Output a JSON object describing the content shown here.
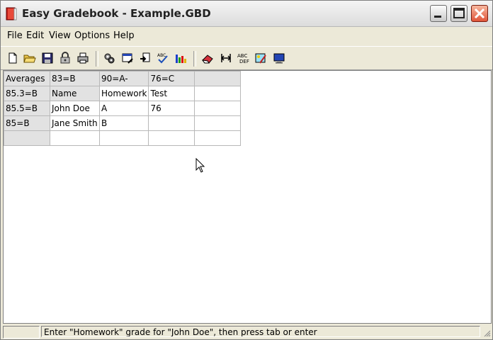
{
  "window": {
    "title": "Easy Gradebook - Example.GBD"
  },
  "menu": {
    "items": [
      "File",
      "Edit",
      "View",
      "Options",
      "Help"
    ]
  },
  "toolbar": {
    "icons": [
      "new-file-icon",
      "open-folder-icon",
      "save-disk-icon",
      "lock-icon",
      "print-icon",
      "settings-gears-icon",
      "window-edit-icon",
      "document-arrow-icon",
      "spell-check-icon",
      "bar-chart-icon",
      "eraser-icon",
      "column-width-icon",
      "abc-def-icon",
      "picture-edit-icon",
      "monitor-icon"
    ]
  },
  "grid": {
    "rows": [
      [
        "Averages",
        "83=B",
        "90=A-",
        "76=C",
        ""
      ],
      [
        "85.3=B",
        "Name",
        "Homework",
        "Test",
        ""
      ],
      [
        "85.5=B",
        "John Doe",
        "A",
        "76",
        ""
      ],
      [
        "85=B",
        "Jane Smith",
        "B",
        "",
        ""
      ],
      [
        "",
        "",
        "",
        "",
        ""
      ]
    ]
  },
  "status": {
    "message": "Enter \"Homework\" grade for \"John Doe\", then press tab or enter"
  },
  "colors": {
    "close_button": "#e0553a",
    "header_cell": "#e2e2e2",
    "window_bg": "#ece9d8"
  }
}
